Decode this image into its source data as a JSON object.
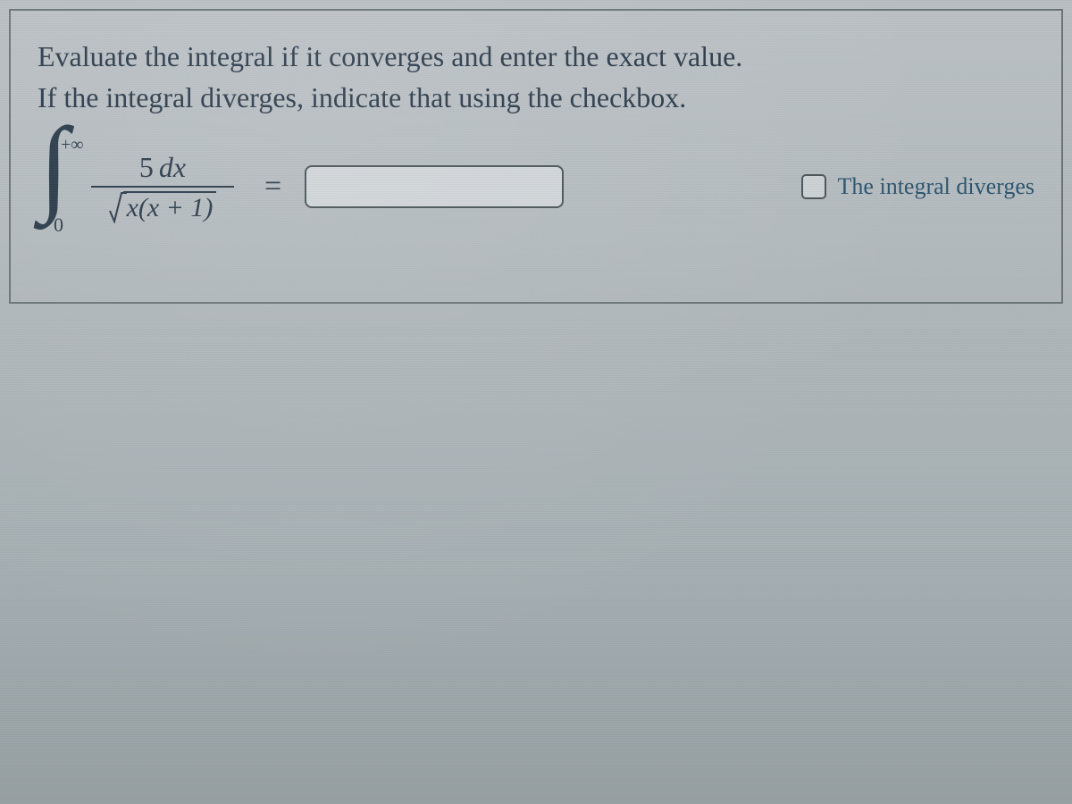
{
  "instructions": {
    "line1": "Evaluate the integral if it converges and enter the exact value.",
    "line2": "If the integral diverges, indicate that using the checkbox."
  },
  "integral": {
    "upper_limit": "+∞",
    "lower_limit": "0",
    "numerator_coeff": "5",
    "numerator_dx": "dx",
    "denominator_radicand": "x(x + 1)",
    "equals": "="
  },
  "answer_value": "",
  "diverges": {
    "checked": false,
    "label": "The integral diverges"
  }
}
